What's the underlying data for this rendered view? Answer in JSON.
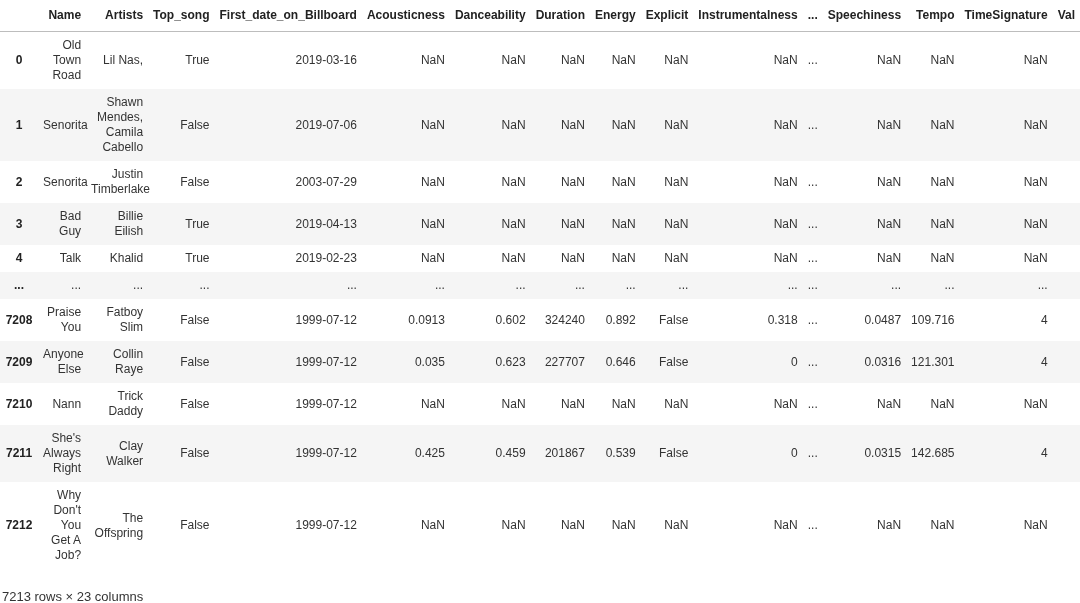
{
  "table": {
    "columns": [
      "Name",
      "Artists",
      "Top_song",
      "First_date_on_Billboard",
      "Acousticness",
      "Danceability",
      "Duration",
      "Energy",
      "Explicit",
      "Instrumentalness",
      "...",
      "Speechiness",
      "Tempo",
      "TimeSignature",
      "Val"
    ],
    "rows": [
      {
        "index": "0",
        "cells": [
          "Old Town Road",
          "Lil Nas,",
          "True",
          "2019-03-16",
          "NaN",
          "NaN",
          "NaN",
          "NaN",
          "NaN",
          "NaN",
          "...",
          "NaN",
          "NaN",
          "NaN"
        ]
      },
      {
        "index": "1",
        "cells": [
          "Senorita",
          "Shawn Mendes, Camila Cabello",
          "False",
          "2019-07-06",
          "NaN",
          "NaN",
          "NaN",
          "NaN",
          "NaN",
          "NaN",
          "...",
          "NaN",
          "NaN",
          "NaN"
        ]
      },
      {
        "index": "2",
        "cells": [
          "Senorita",
          "Justin Timberlake",
          "False",
          "2003-07-29",
          "NaN",
          "NaN",
          "NaN",
          "NaN",
          "NaN",
          "NaN",
          "...",
          "NaN",
          "NaN",
          "NaN"
        ]
      },
      {
        "index": "3",
        "cells": [
          "Bad Guy",
          "Billie Eilish",
          "True",
          "2019-04-13",
          "NaN",
          "NaN",
          "NaN",
          "NaN",
          "NaN",
          "NaN",
          "...",
          "NaN",
          "NaN",
          "NaN"
        ]
      },
      {
        "index": "4",
        "cells": [
          "Talk",
          "Khalid",
          "True",
          "2019-02-23",
          "NaN",
          "NaN",
          "NaN",
          "NaN",
          "NaN",
          "NaN",
          "...",
          "NaN",
          "NaN",
          "NaN"
        ]
      },
      {
        "index": "...",
        "cells": [
          "...",
          "...",
          "...",
          "...",
          "...",
          "...",
          "...",
          "...",
          "...",
          "...",
          "...",
          "...",
          "...",
          "..."
        ]
      },
      {
        "index": "7208",
        "cells": [
          "Praise You",
          "Fatboy Slim",
          "False",
          "1999-07-12",
          "0.0913",
          "0.602",
          "324240",
          "0.892",
          "False",
          "0.318",
          "...",
          "0.0487",
          "109.716",
          "4"
        ]
      },
      {
        "index": "7209",
        "cells": [
          "Anyone Else",
          "Collin Raye",
          "False",
          "1999-07-12",
          "0.035",
          "0.623",
          "227707",
          "0.646",
          "False",
          "0",
          "...",
          "0.0316",
          "121.301",
          "4"
        ]
      },
      {
        "index": "7210",
        "cells": [
          "Nann",
          "Trick Daddy",
          "False",
          "1999-07-12",
          "NaN",
          "NaN",
          "NaN",
          "NaN",
          "NaN",
          "NaN",
          "...",
          "NaN",
          "NaN",
          "NaN"
        ]
      },
      {
        "index": "7211",
        "cells": [
          "She's Always Right",
          "Clay Walker",
          "False",
          "1999-07-12",
          "0.425",
          "0.459",
          "201867",
          "0.539",
          "False",
          "0",
          "...",
          "0.0315",
          "142.685",
          "4"
        ]
      },
      {
        "index": "7212",
        "cells": [
          "Why Don't You Get A Job?",
          "The Offspring",
          "False",
          "1999-07-12",
          "NaN",
          "NaN",
          "NaN",
          "NaN",
          "NaN",
          "NaN",
          "...",
          "NaN",
          "NaN",
          "NaN"
        ]
      }
    ]
  },
  "footer": "7213 rows × 23 columns"
}
